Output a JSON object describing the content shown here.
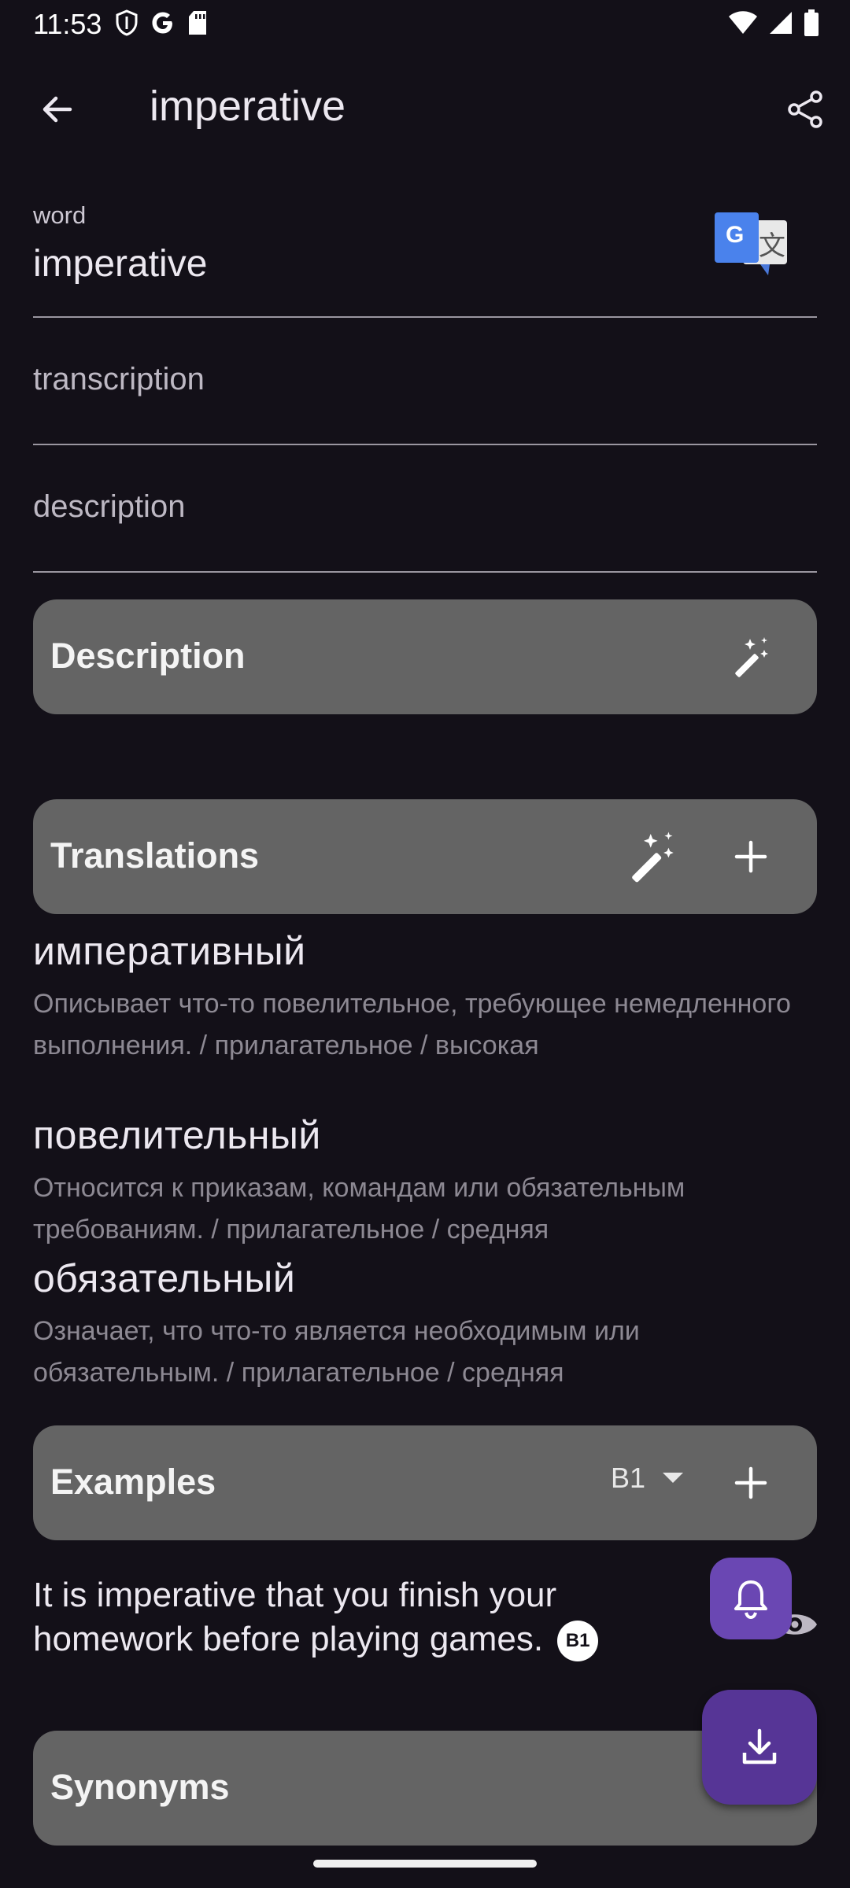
{
  "status_bar": {
    "time": "11:53"
  },
  "app_bar": {
    "title": "imperative"
  },
  "fields": {
    "word_label": "word",
    "word_value": "imperative",
    "transcription_placeholder": "transcription",
    "description_placeholder": "description"
  },
  "sections": {
    "description_title": "Description",
    "translations_title": "Translations",
    "examples_title": "Examples",
    "synonyms_title": "Synonyms"
  },
  "translations": [
    {
      "word": "императивный",
      "description": "Описывает что-то повелительное, требующее немедленного выполнения. / прилагательное / высокая"
    },
    {
      "word": "повелительный",
      "description": "Относится к приказам, командам или обязательным требованиям. / прилагательное / средняя"
    },
    {
      "word": "обязательный",
      "description": "Означает, что что-то является необходимым или обязательным. / прилагательное / средняя"
    }
  ],
  "examples": {
    "level_selected": "B1",
    "items": [
      {
        "text": "It is imperative that you finish your homework before playing games.",
        "level": "B1"
      }
    ]
  },
  "colors": {
    "background": "#131018",
    "section_card": "#646464",
    "fab_primary": "#563596",
    "fab_secondary": "#6a47b3"
  }
}
